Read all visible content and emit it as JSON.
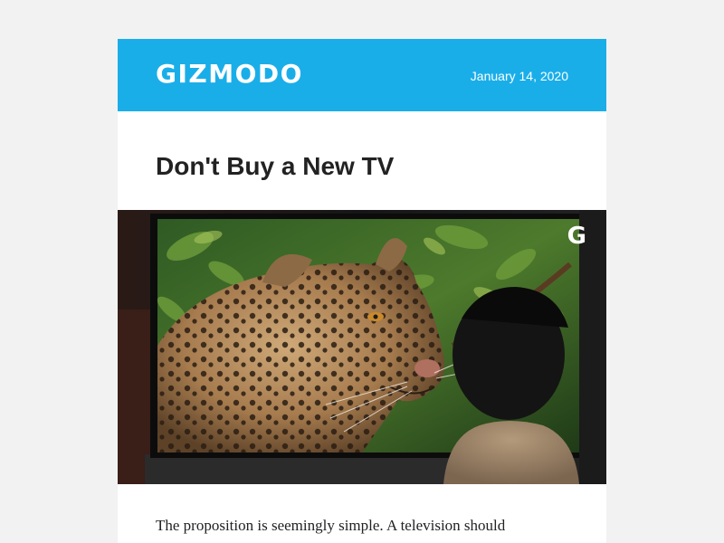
{
  "header": {
    "logo": "GIZMODO",
    "date": "January 14, 2020",
    "background_color": "#1aaee9"
  },
  "article": {
    "title": "Don't Buy a New TV",
    "hero_badge": "G",
    "hero_image_icon": "tv-leopard-photo-icon",
    "body_first_line": "The proposition is seemingly simple. A television should"
  }
}
